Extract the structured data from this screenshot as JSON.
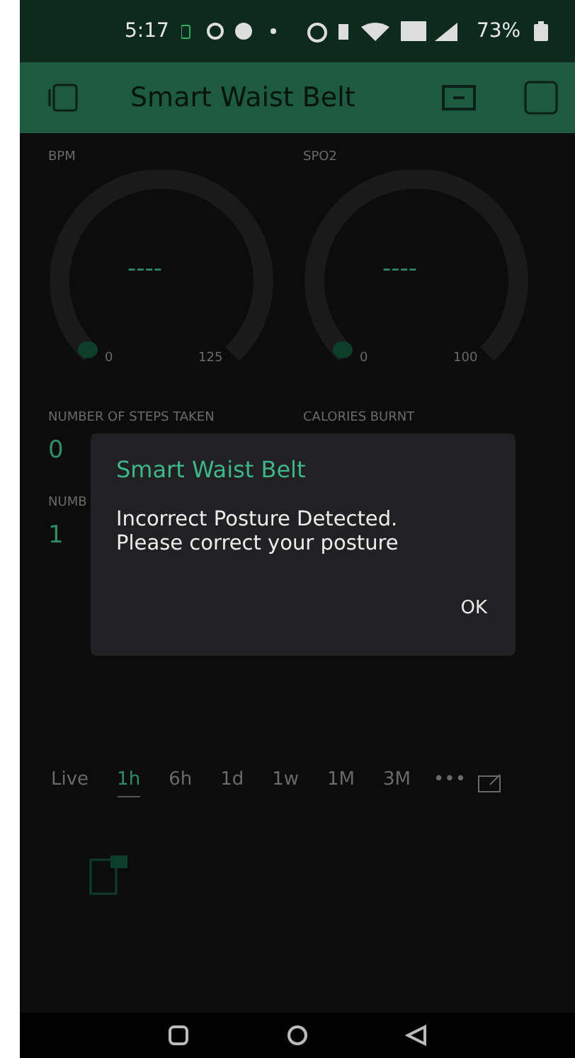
{
  "status_bar": {
    "time": "5:17",
    "battery": "73%"
  },
  "header": {
    "title": "Smart Waist Belt"
  },
  "gauges": [
    {
      "label": "BPM",
      "value": "----",
      "min": "0",
      "max": "125"
    },
    {
      "label": "SPO2",
      "value": "----",
      "min": "0",
      "max": "100"
    }
  ],
  "displays": [
    {
      "label": "NUMBER OF STEPS TAKEN",
      "value": "0"
    },
    {
      "label": "CALORIES BURNT"
    },
    {
      "label": "NUMB",
      "value": "1"
    }
  ],
  "time_ranges": [
    {
      "label": "Live",
      "selected": false
    },
    {
      "label": "1h",
      "selected": true
    },
    {
      "label": "6h",
      "selected": false
    },
    {
      "label": "1d",
      "selected": false
    },
    {
      "label": "1w",
      "selected": false
    },
    {
      "label": "1M",
      "selected": false
    },
    {
      "label": "3M",
      "selected": false
    }
  ],
  "more": "•••",
  "dialog": {
    "title": "Smart Waist Belt",
    "message": "Incorrect Posture Detected.\nPlease correct your posture",
    "button": "OK"
  }
}
